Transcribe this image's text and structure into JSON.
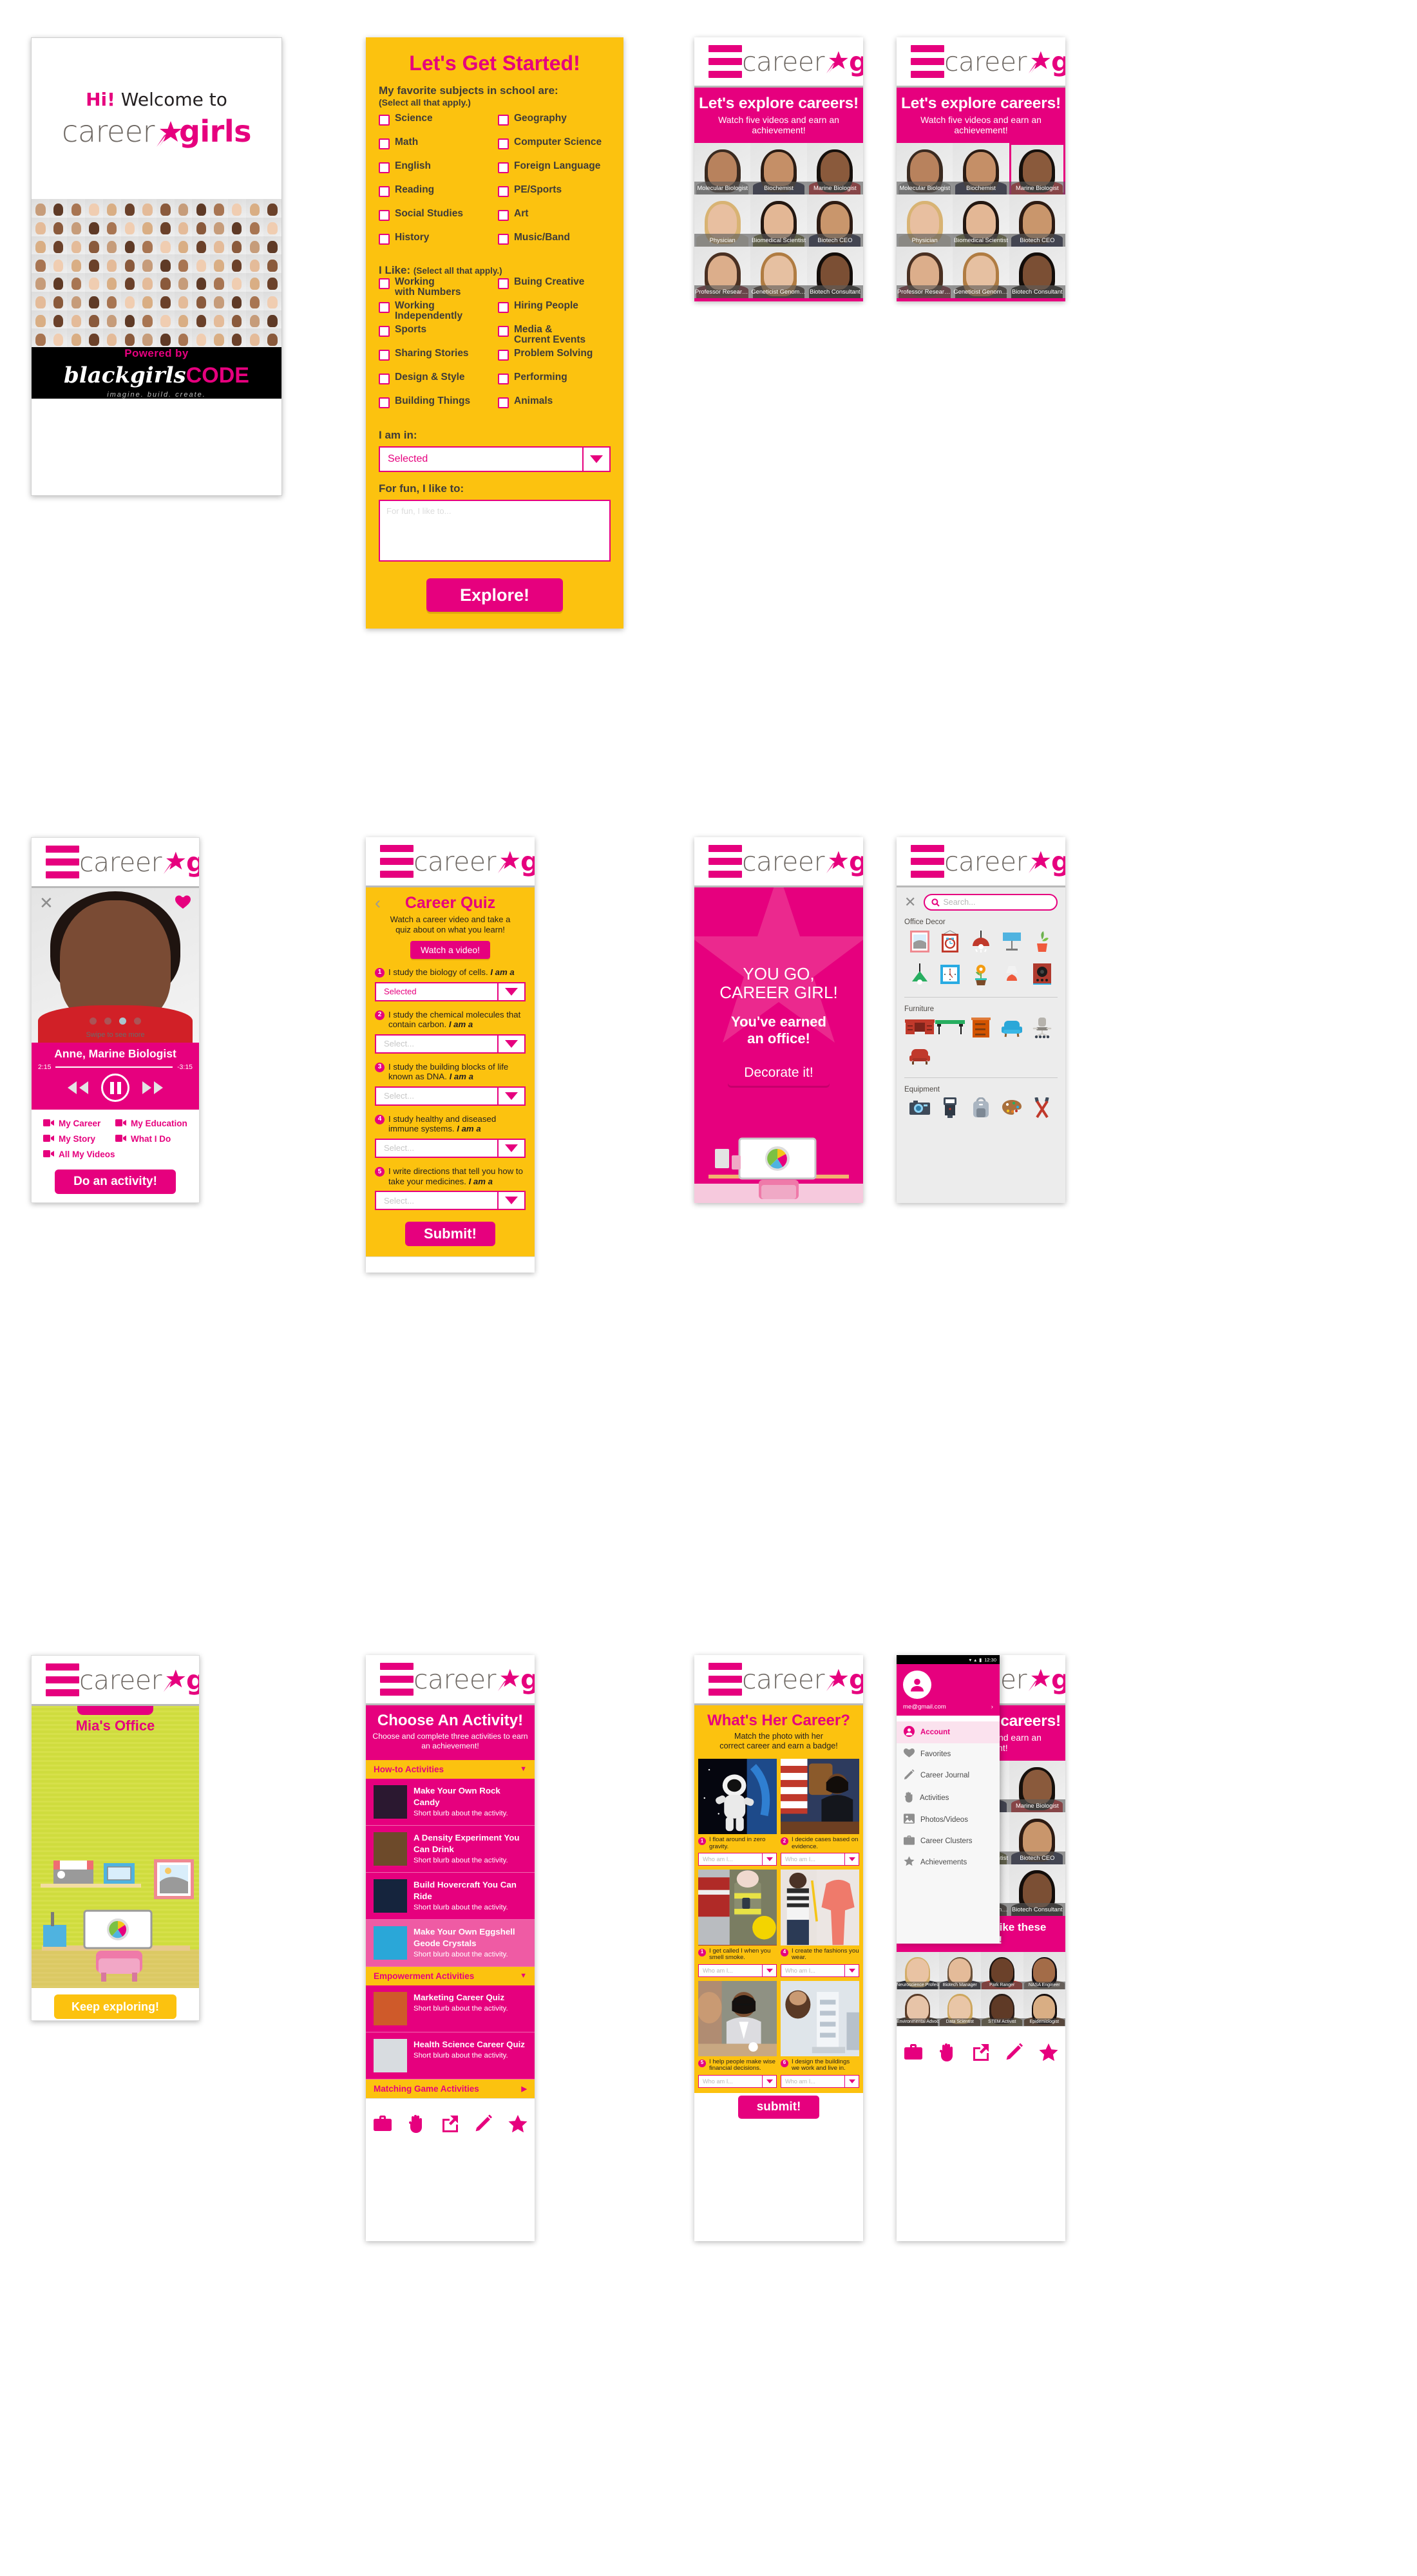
{
  "brand": {
    "name_part1": "career",
    "name_part2": "girls",
    "pink": "#e6007e",
    "yellow": "#fcc20f",
    "gray": "#6d6762"
  },
  "splash": {
    "hi": "Hi!",
    "welcome_to": " Welcome to",
    "powered_by": "Powered by",
    "bgc_black": "black",
    "bgc_girls": "girls",
    "bgc_code": "CODE",
    "bgc_tagline": "imagine. build. create."
  },
  "get_started": {
    "title": "Let's Get Started!",
    "subjects_label": "My favorite subjects in school are:",
    "select_all": "(Select all that apply.)",
    "subjects_left": [
      "Science",
      "Math",
      "English",
      "Reading",
      "Social Studies",
      "History"
    ],
    "subjects_right": [
      "Geography",
      "Computer Science",
      "Foreign Language",
      "PE/Sports",
      "Art",
      "Music/Band"
    ],
    "ilike_label": "I Like:",
    "ilike_note": "(Select all that apply.)",
    "likes_left": [
      "Working\nwith Numbers",
      "Working\nIndependently",
      "Sports",
      "Sharing Stories",
      "Design & Style",
      "Building Things"
    ],
    "likes_right": [
      "Buing Creative",
      "Hiring People",
      "Media &\nCurrent Events",
      "Problem Solving",
      "Performing",
      "Animals"
    ],
    "iamin_label": "I am in:",
    "iamin_value": "Selected",
    "forfun_label": "For fun, I like to:",
    "forfun_placeholder": "For fun, I like to...",
    "explore_button": "Explore!"
  },
  "explore": {
    "banner_title": "Let's explore careers!",
    "banner_sub": "Watch five videos and earn an achievement!",
    "also_like": "You might also like these careers!",
    "careers": [
      {
        "label": "Molecular Biologist",
        "skin": "#b8825d",
        "hair": "#3a2a20",
        "shirt": "#9b9b9b"
      },
      {
        "label": "Biochemist",
        "skin": "#c58f67",
        "hair": "#2b1c14",
        "shirt": "#1e2140"
      },
      {
        "label": "Marine Biologist",
        "skin": "#8a5a3c",
        "hair": "#16100c",
        "shirt": "#cc2229"
      },
      {
        "label": "Physician",
        "skin": "#e8bfa0",
        "hair": "#d8b373",
        "shirt": "#d8d2c4"
      },
      {
        "label": "Biomedical Scientist",
        "skin": "#e3b795",
        "hair": "#231711",
        "shirt": "#6b6a33"
      },
      {
        "label": "Biotech CEO",
        "skin": "#c9966c",
        "hair": "#2d1b13",
        "shirt": "#1d2243"
      },
      {
        "label": "Professor Researcher",
        "skin": "#dcae8b",
        "hair": "#4a3022",
        "shirt": "#7e2430"
      },
      {
        "label": "Geneticist Genomicist",
        "skin": "#e6c0a1",
        "hair": "#b07c42",
        "shirt": "#3b2a22"
      },
      {
        "label": "Biotech Consultant",
        "skin": "#7b4f34",
        "hair": "#130d0a",
        "shirt": "#171512"
      }
    ],
    "also_careers": [
      {
        "label": "Neuroscience Professor",
        "skin": "#e9c3a3",
        "hair": "#d3ad6a",
        "shirt": "#20222b"
      },
      {
        "label": "Biotech Manager",
        "skin": "#e4bb99",
        "hair": "#6a513a",
        "shirt": "#3c3a46"
      },
      {
        "label": "Park Ranger",
        "skin": "#6b412a",
        "hair": "#1b1410",
        "shirt": "#c23f38"
      },
      {
        "label": "NASA Engineer",
        "skin": "#a36c48",
        "hair": "#171014",
        "shirt": "#8d7f74"
      },
      {
        "label": "Environmental Advocate",
        "skin": "#e7c4a8",
        "hair": "#5a3c28",
        "shirt": "#3a3026"
      },
      {
        "label": "Data Scientist",
        "skin": "#e9c6a7",
        "hair": "#cda75e",
        "shirt": "#6a5646"
      },
      {
        "label": "STEM Activist",
        "skin": "#5f3a26",
        "hair": "#2a1d18",
        "shirt": "#7d7252"
      },
      {
        "label": "Epidemiologist",
        "skin": "#d9ae84",
        "hair": "#170f0d",
        "shirt": "#6d4a32"
      }
    ]
  },
  "bottom_nav": [
    "briefcase-icon",
    "hand-icon",
    "share-icon",
    "pencil-icon",
    "star-icon"
  ],
  "video": {
    "person_name": "Anne, Marine Biologist",
    "swipe_hint": "Swipe to see more",
    "time_elapsed": "2:15",
    "time_remaining": "-3:15",
    "links": [
      "My Career",
      "My Education",
      "My Story",
      "What I Do",
      "All My Videos"
    ],
    "activity_button": "Do an activity!"
  },
  "quiz": {
    "title": "Career Quiz",
    "subtitle": "Watch a career video and take a\nquiz about on what you learn!",
    "watch_button": "Watch a video!",
    "questions": [
      {
        "n": "1",
        "text": "I study the biology of cells. ",
        "em": "I am a",
        "value": "Selected",
        "is_placeholder": false
      },
      {
        "n": "2",
        "text": "I study the chemical molecules that contain carbon. ",
        "em": "I am a",
        "value": "Select...",
        "is_placeholder": true
      },
      {
        "n": "3",
        "text": "I study the building blocks of life known as DNA. ",
        "em": "I am a",
        "value": "Select...",
        "is_placeholder": true
      },
      {
        "n": "4",
        "text": "I study healthy and diseased immune systems. ",
        "em": "I am a",
        "value": "Select...",
        "is_placeholder": true
      },
      {
        "n": "5",
        "text": "I write directions that tell you how to take your medicines. ",
        "em": "I am a",
        "value": "Select...",
        "is_placeholder": true
      }
    ],
    "submit_button": "Submit!"
  },
  "congrats": {
    "line1": "YOU GO,",
    "line2": "CAREER GIRL!",
    "line3": "You've earned",
    "line4": "an office!",
    "button": "Decorate it!"
  },
  "decor": {
    "search_placeholder": "Search...",
    "sections": [
      {
        "title": "Office Decor",
        "items": [
          "framed-landscape-icon",
          "framed-clock-icon",
          "red-pendant-lamp-icon",
          "blue-desk-lamp-icon",
          "orange-vase-plant-icon",
          "green-pendant-lamp-icon",
          "blue-wall-clock-icon",
          "orange-flower-pot-icon",
          "red-table-lamp-icon",
          "red-speaker-icon"
        ]
      },
      {
        "title": "Furniture",
        "items": [
          "red-desk-icon",
          "green-shelf-desk-icon",
          "orange-drawers-icon",
          "blue-armchair-icon",
          "office-chair-icon",
          "red-sofa-chair-icon"
        ]
      },
      {
        "title": "Equipment",
        "items": [
          "camera-icon",
          "flash-icon",
          "backpack-icon",
          "paint-palette-icon",
          "brushes-icon"
        ]
      }
    ]
  },
  "office": {
    "title": "Mia's Office",
    "keep_button": "Keep exploring!"
  },
  "activities": {
    "title": "Choose An Activity!",
    "subtitle": "Choose and complete three activities to earn an achievement!",
    "blurb": "Short blurb about the activity.",
    "groups": [
      {
        "name": "How-to Activities",
        "chevron": "▼",
        "items": [
          {
            "title": "Make Your Own Rock Candy",
            "thumb": "#2b1830"
          },
          {
            "title": "A Density Experiment You Can Drink",
            "thumb": "#6d4a2a"
          },
          {
            "title": "Build Hovercraft You Can Ride",
            "thumb": "#15243d"
          },
          {
            "title": "Make Your Own Eggshell Geode Crystals",
            "thumb": "#2aa7d8"
          }
        ]
      },
      {
        "name": "Empowerment Activities",
        "chevron": "▼",
        "items": [
          {
            "title": "Marketing Career Quiz",
            "thumb": "#cf5a2a"
          },
          {
            "title": "Health Science Career Quiz",
            "thumb": "#d8dce0"
          }
        ]
      },
      {
        "name": "Matching Game Activities",
        "chevron": "▶",
        "items": []
      }
    ]
  },
  "matching": {
    "title": "What's Her Career?",
    "subtitle": "Match the photo with her\ncorrect career and earn a badge!",
    "select_placeholder": "Who am I...",
    "submit_button": "submit!",
    "cards": [
      {
        "n": "1",
        "prompt": "I float around in zero gravity.",
        "bg": "#05060f",
        "kind": "astronaut"
      },
      {
        "n": "2",
        "prompt": "I decide cases based on evidence.",
        "bg": "#8f2a2c",
        "kind": "judge"
      },
      {
        "n": "1",
        "prompt": "I get called I when you smell smoke.",
        "bg": "#9c2b28",
        "kind": "firefighter"
      },
      {
        "n": "4",
        "prompt": "I create the fashions you wear.",
        "bg": "#e7dad5",
        "kind": "designer"
      },
      {
        "n": "5",
        "prompt": "I help people make wise financial decisions.",
        "bg": "#8d8f80",
        "kind": "advisor"
      },
      {
        "n": "6",
        "prompt": "I design the buildings we work and live in.",
        "bg": "#cdd4dc",
        "kind": "architect"
      }
    ]
  },
  "drawer": {
    "email": "me@gmail.com",
    "time": "12:30",
    "items": [
      {
        "label": "Account",
        "icon": "account-icon",
        "active": true
      },
      {
        "label": "Favorites",
        "icon": "heart-icon",
        "active": false
      },
      {
        "label": "Career Journal",
        "icon": "pencil-icon",
        "active": false
      },
      {
        "label": "Activities",
        "icon": "hand-icon",
        "active": false
      },
      {
        "label": "Photos/Videos",
        "icon": "photo-icon",
        "active": false
      },
      {
        "label": "Career Clusters",
        "icon": "briefcase-icon",
        "active": false
      },
      {
        "label": "Achievements",
        "icon": "star-icon",
        "active": false
      }
    ]
  }
}
